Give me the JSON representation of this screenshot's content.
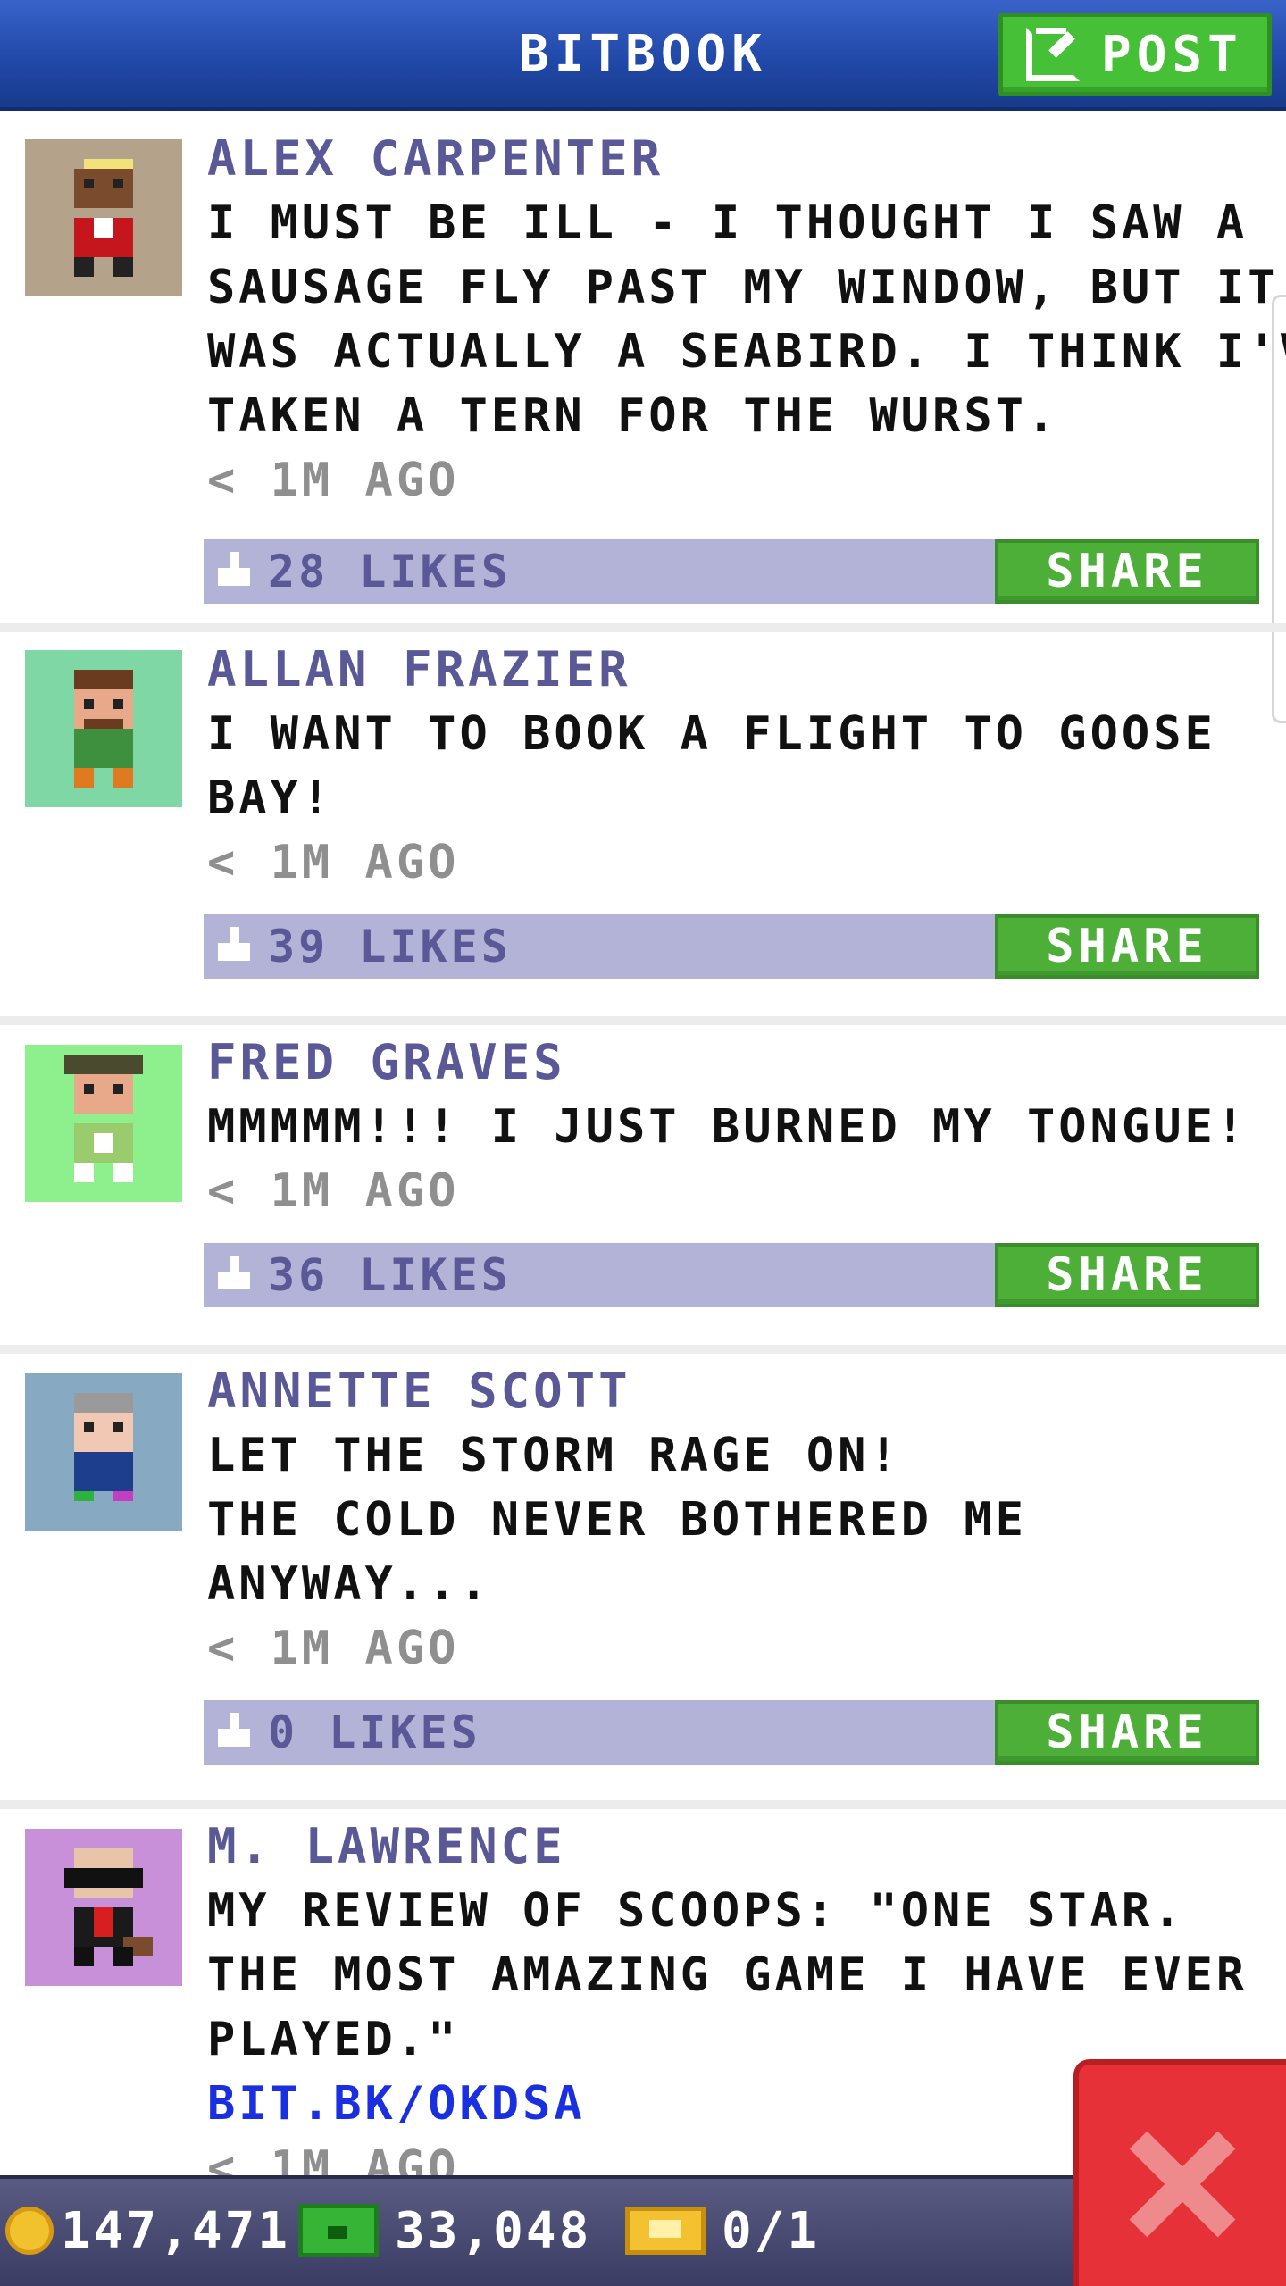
{
  "header": {
    "title": "BITBOOK",
    "post_label": "POST"
  },
  "posts": [
    {
      "author": "ALEX CARPENTER",
      "lines": [
        "I MUST BE ILL - I THOUGHT I SAW A",
        "SAUSAGE FLY PAST MY WINDOW, BUT IT",
        "WAS ACTUALLY A SEABIRD. I THINK I'VE",
        "TAKEN A TERN FOR THE WURST."
      ],
      "time": "< 1M AGO",
      "likes": "28 LIKES",
      "share_label": "SHARE",
      "avatar_bg": "#b5a28a"
    },
    {
      "author": "ALLAN FRAZIER",
      "lines": [
        "I WANT TO BOOK A FLIGHT TO GOOSE",
        "BAY!"
      ],
      "time": "< 1M AGO",
      "likes": "39 LIKES",
      "share_label": "SHARE",
      "avatar_bg": "#7fd7a5"
    },
    {
      "author": "FRED GRAVES",
      "lines": [
        "MMMMM!!! I JUST BURNED MY TONGUE!"
      ],
      "time": "< 1M AGO",
      "likes": "36 LIKES",
      "share_label": "SHARE",
      "avatar_bg": "#8df08d"
    },
    {
      "author": "ANNETTE SCOTT",
      "lines": [
        "LET THE STORM RAGE ON!",
        "THE COLD NEVER BOTHERED ME",
        "ANYWAY..."
      ],
      "time": "< 1M AGO",
      "likes": "0 LIKES",
      "share_label": "SHARE",
      "avatar_bg": "#87a9c2"
    },
    {
      "author": "M. LAWRENCE",
      "lines": [
        "MY REVIEW OF SCOOPS: \"ONE STAR.",
        "THE MOST AMAZING GAME I HAVE EVER",
        "PLAYED.\""
      ],
      "link": "BIT.BK/OKDSA",
      "time": "< 1M AGO",
      "avatar_bg": "#c890d8"
    }
  ],
  "bottom_bar": {
    "coins": "147,471",
    "bux": "33,048",
    "tickets": "0/1"
  },
  "colors": {
    "header_blue": "#2149a9",
    "post_green": "#46c137",
    "author_purple": "#5a5896",
    "likes_bar": "#b2b3d6",
    "share_green": "#4dae38",
    "link_blue": "#1a2fe0",
    "close_red": "#e53137"
  },
  "icons": {
    "post": "edit-icon",
    "like": "thumbs-up-icon",
    "coin": "coin-icon",
    "bux": "bux-icon",
    "ticket": "vip-ticket-icon",
    "close": "close-icon"
  }
}
